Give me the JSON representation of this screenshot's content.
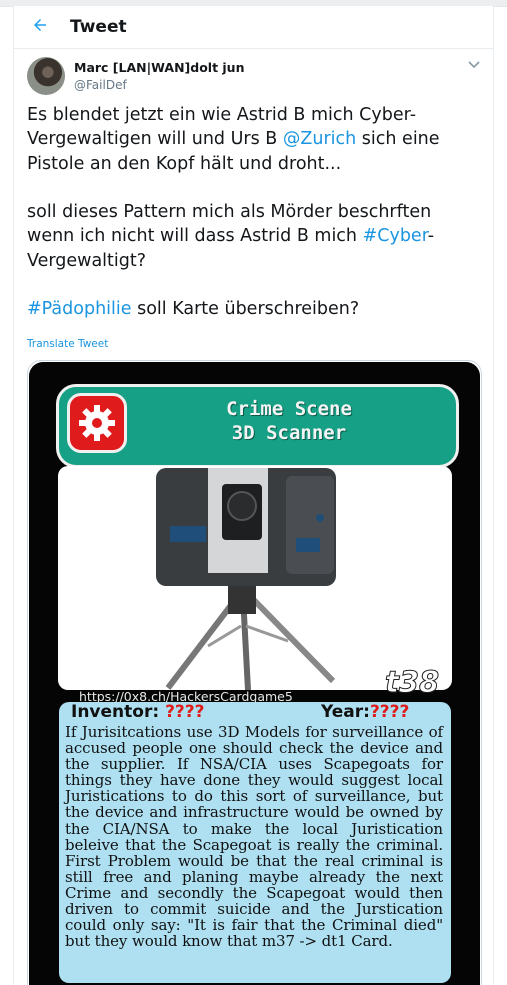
{
  "header": {
    "title": "Tweet",
    "back_icon": "arrow-left-icon"
  },
  "tweet": {
    "author_name": "Marc [LAN|WAN]dolt jun",
    "author_handle": "@FailDef",
    "para1_before": "Es blendet jetzt ein wie Astrid B mich Cyber-Vergewaltigen will und Urs B ",
    "para1_mention": "@Zurich",
    "para1_after": " sich eine Pistole an den Kopf hält und droht...",
    "para2_before": "soll dieses Pattern mich als Mörder beschrften wenn ich nicht will dass Astrid B mich ",
    "para2_hashtag": "#Cyber",
    "para2_after": "-Vergewaltigt?",
    "para3_hashtag": "#Pädophilie",
    "para3_after": " soll Karte überschreiben?",
    "translate_label": "Translate Tweet"
  },
  "card": {
    "title": "Crime Scene\n3D Scanner",
    "url": "https://0x8.ch/HackersCardgame5",
    "card_number": "t38",
    "inventor_label": "Inventor:",
    "inventor_value": "????",
    "year_label": "Year:",
    "year_value": "????",
    "description": "If Jurisitcations use 3D Models for surveillance of accused people one should check the device and the supplier. If NSA/CIA uses Scapegoats for things they have done they would suggest local Juristications to do this sort of surveillance, but the device and infrastructure would be owned by the CIA/NSA to make the local Juristication beleive that the Scapegoat is really the criminal. First Problem would be that the real criminal is still free and planing maybe already the next Crime and secondly the Scapegoat would then driven to commit suicide and the Jurstication could only say: \"It is fair that the Criminal died\" but they would know that m37 -> dt1 Card.",
    "colors": {
      "banner": "#16a085",
      "gear_box": "#e01b1b",
      "info_bg": "#aee0f2",
      "link": "#1b95e0"
    }
  }
}
